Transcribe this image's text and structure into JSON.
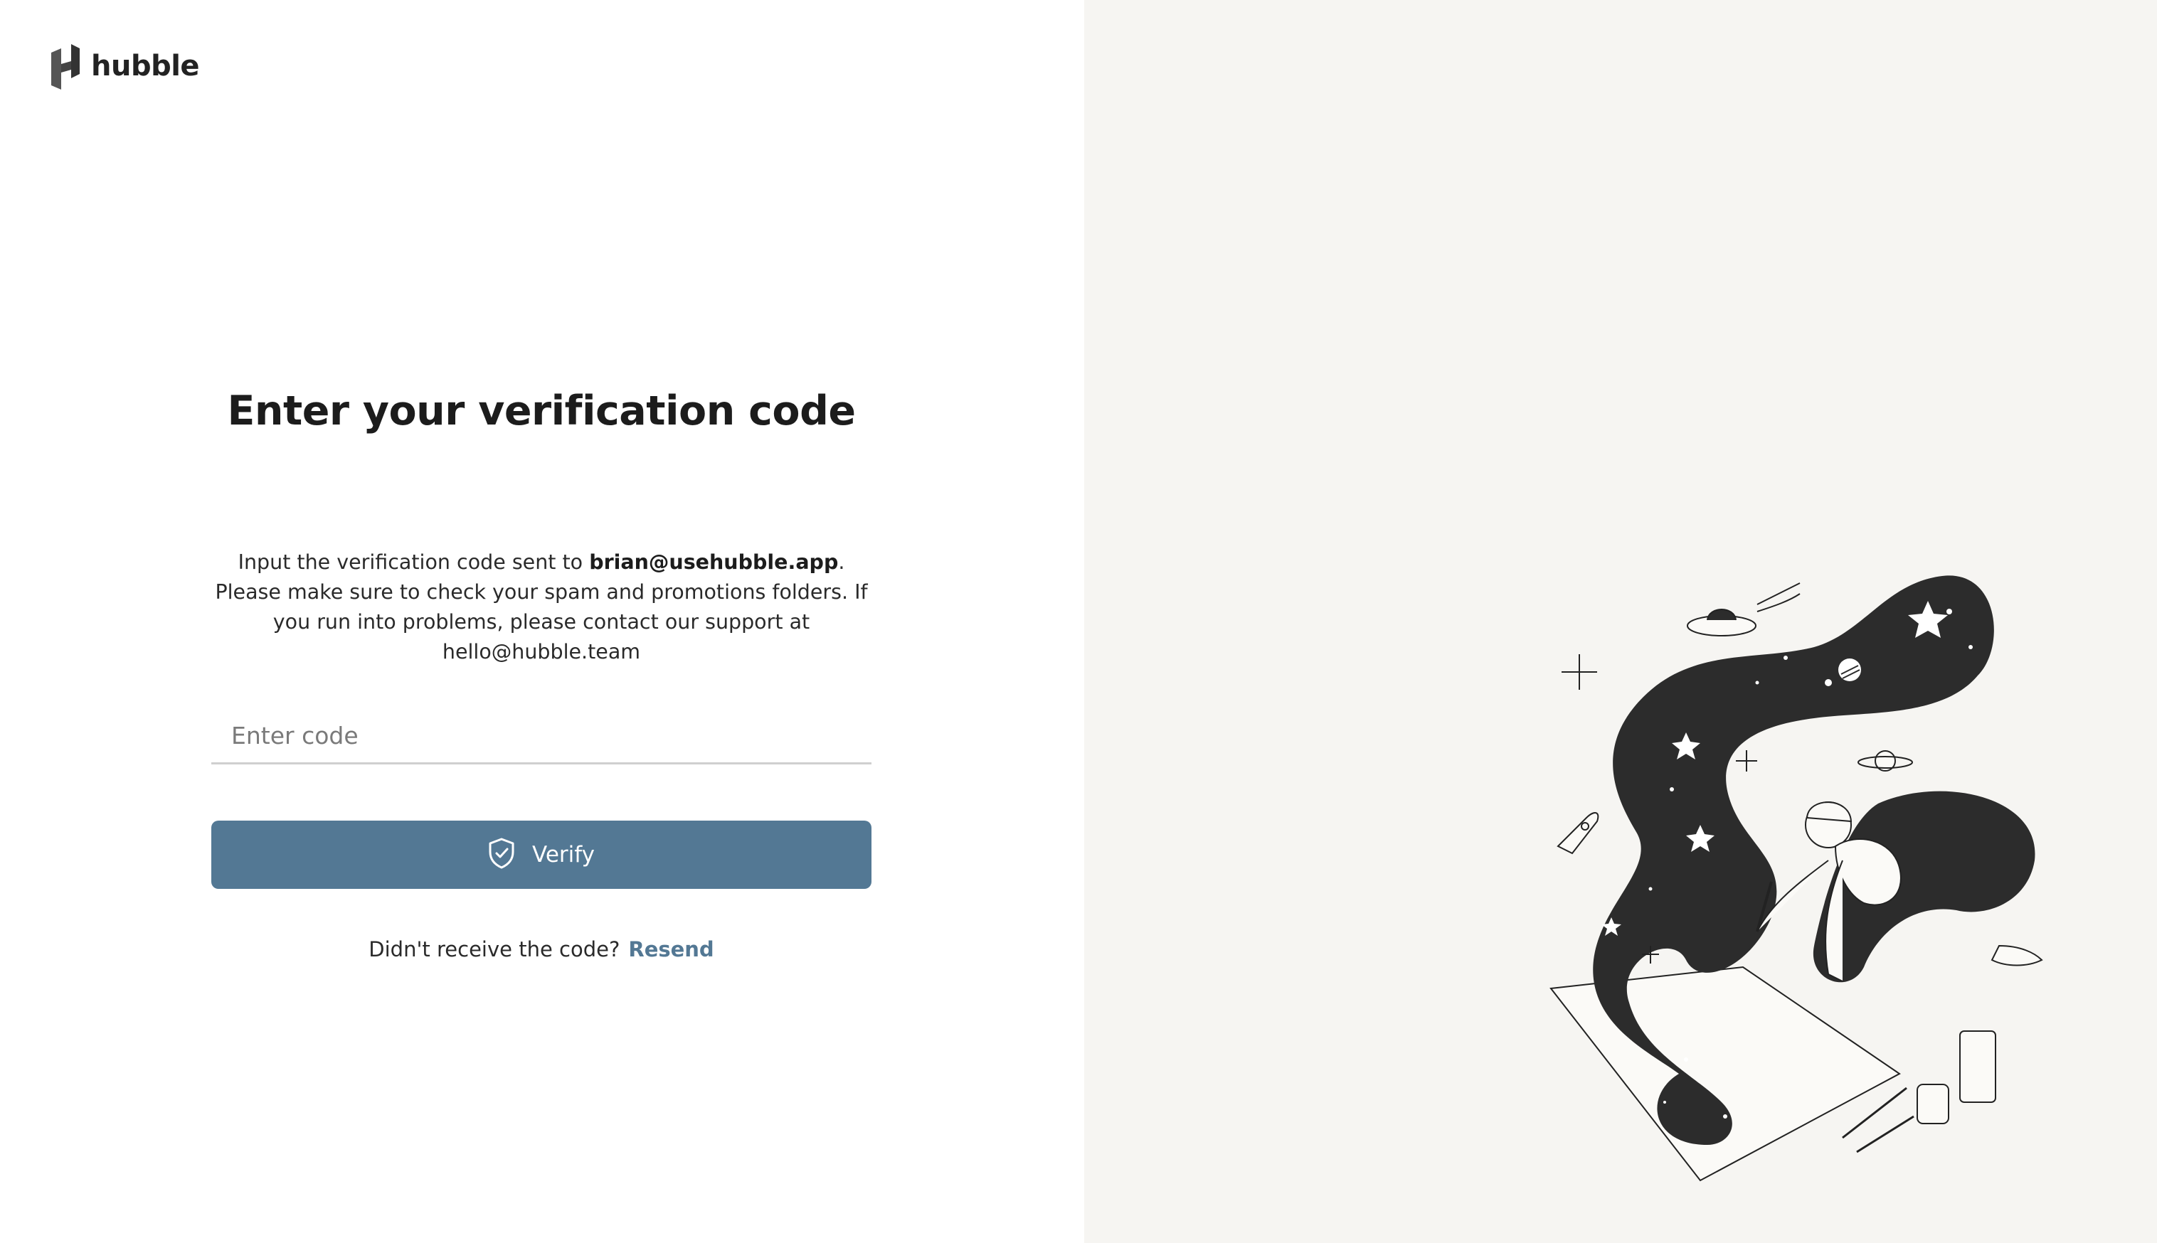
{
  "brand": {
    "name": "hubble"
  },
  "verification": {
    "title": "Enter your verification code",
    "description_prefix": "Input the verification code sent to ",
    "email": "brian@usehubble.app",
    "description_suffix": ". Please make sure to check your spam and promotions folders. If you run into problems, please contact our support at hello@hubble.team",
    "code_placeholder": "Enter code",
    "code_value": "",
    "verify_label": "Verify",
    "resend_prompt": "Didn't receive the code?",
    "resend_label": "Resend"
  },
  "colors": {
    "accent": "#537894",
    "right_panel_bg": "#f6f5f2",
    "text": "#1c1c1c"
  },
  "icons": {
    "logo": "hubble-logo-icon",
    "verify": "shield-check-icon"
  }
}
